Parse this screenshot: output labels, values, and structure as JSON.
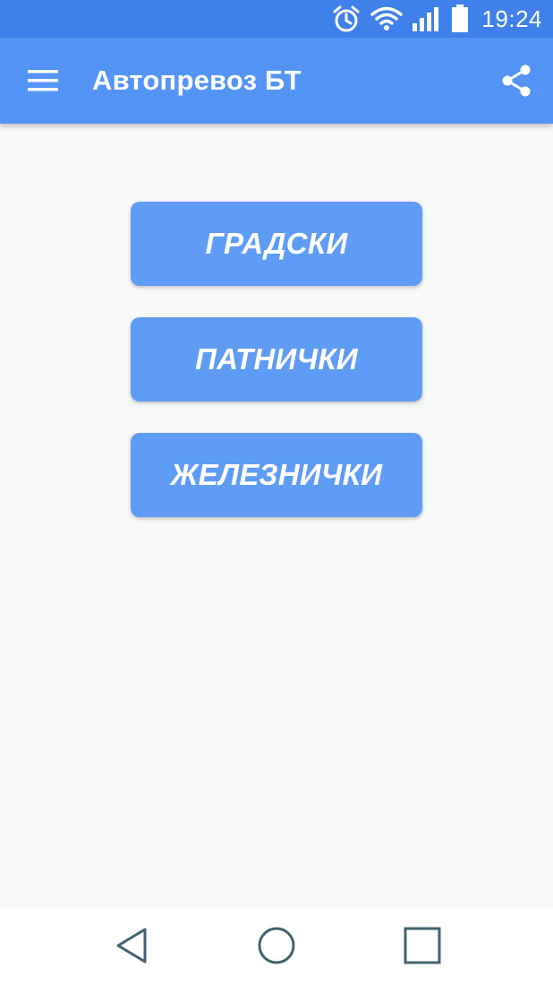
{
  "status_bar": {
    "time": "19:24",
    "icons": [
      "alarm-icon",
      "wifi-icon",
      "signal-icon",
      "battery-icon"
    ]
  },
  "app_bar": {
    "title": "Автопревоз БТ",
    "menu_icon": "hamburger-menu-icon",
    "share_icon": "share-icon"
  },
  "main": {
    "buttons": [
      {
        "label": "ГРАДСКИ"
      },
      {
        "label": "ПАТНИЧКИ"
      },
      {
        "label": "ЖЕЛЕЗНИЧКИ"
      }
    ]
  },
  "nav_bar": {
    "icons": [
      "back-icon",
      "home-icon",
      "recent-apps-icon"
    ]
  },
  "colors": {
    "status_bar": "#3f80ea",
    "app_bar": "#5394f6",
    "button": "#5f9cf6",
    "background": "#f7f8f8",
    "nav_icon": "#41626e"
  }
}
